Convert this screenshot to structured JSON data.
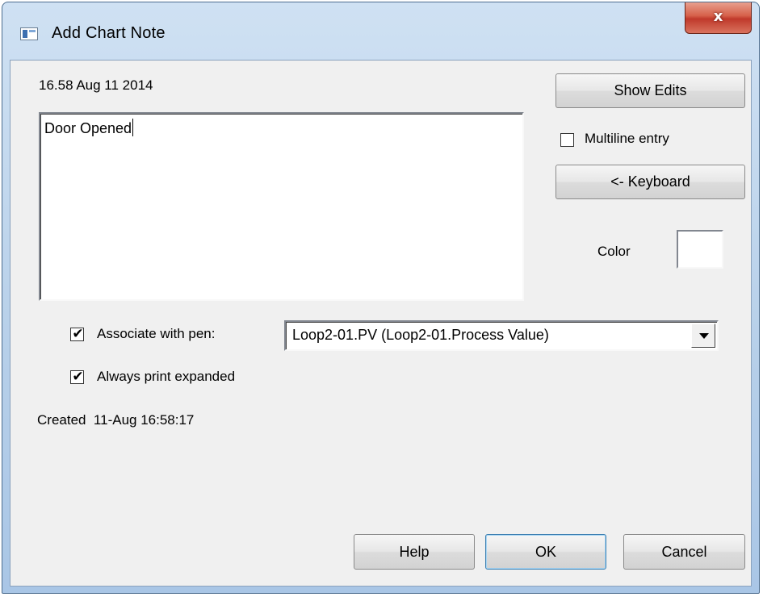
{
  "window": {
    "title": "Add Chart Note",
    "close_label": "x"
  },
  "note": {
    "timestamp": "16.58 Aug 11 2014",
    "text": "Door Opened"
  },
  "side": {
    "show_edits_label": "Show Edits",
    "multiline_label": "Multiline entry",
    "multiline_checked": false,
    "keyboard_label": "<- Keyboard",
    "color_label": "Color",
    "color_value": "#ffffff"
  },
  "options": {
    "associate_label": "Associate with pen:",
    "associate_checked": true,
    "pen_selected": "Loop2-01.PV (Loop2-01.Process Value)",
    "always_print_label": "Always print expanded",
    "always_print_checked": true,
    "check_glyph": "✔"
  },
  "created": "Created  11-Aug 16:58:17",
  "buttons": {
    "help": "Help",
    "ok": "OK",
    "cancel": "Cancel"
  }
}
